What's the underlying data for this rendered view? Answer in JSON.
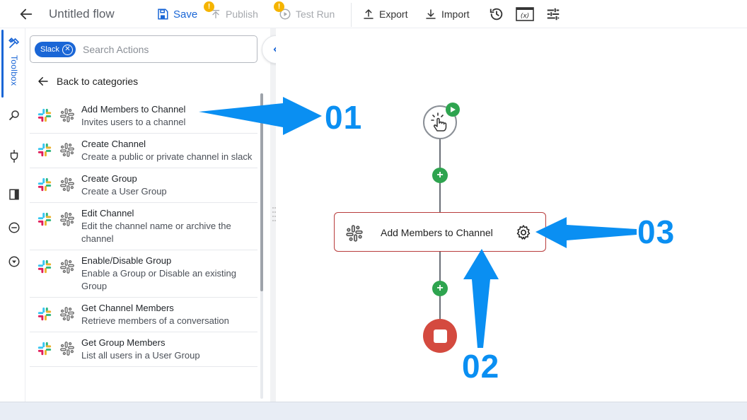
{
  "topbar": {
    "flow_title": "Untitled flow",
    "save_label": "Save",
    "publish_label": "Publish",
    "test_run_label": "Test Run",
    "export_label": "Export",
    "import_label": "Import",
    "warn_badge": "!"
  },
  "rail": {
    "toolbox_label": "Toolbox"
  },
  "panel": {
    "filter_chip": "Slack",
    "search_placeholder": "Search Actions",
    "back_label": "Back to categories",
    "items": [
      {
        "name": "Add Members to Channel",
        "desc": "Invites users to a channel"
      },
      {
        "name": "Create Channel",
        "desc": "Create a public or private channel in slack"
      },
      {
        "name": "Create Group",
        "desc": "Create a User Group"
      },
      {
        "name": "Edit Channel",
        "desc": "Edit the channel name or archive the channel"
      },
      {
        "name": "Enable/Disable Group",
        "desc": "Enable a Group or Disable an existing Group"
      },
      {
        "name": "Get Channel Members",
        "desc": "Retrieve members of a conversation"
      },
      {
        "name": "Get Group Members",
        "desc": "List all users in a User Group"
      }
    ]
  },
  "canvas": {
    "step_label": "Add Members to Channel"
  },
  "annotations": {
    "callout_1": "01",
    "callout_2": "02",
    "callout_3": "03"
  },
  "colors": {
    "accent": "#1a66d6",
    "add_green": "#2ea44f",
    "stop_red": "#d44a3f",
    "step_border": "#b83c3c",
    "annotation_blue": "#0a8ff2"
  }
}
